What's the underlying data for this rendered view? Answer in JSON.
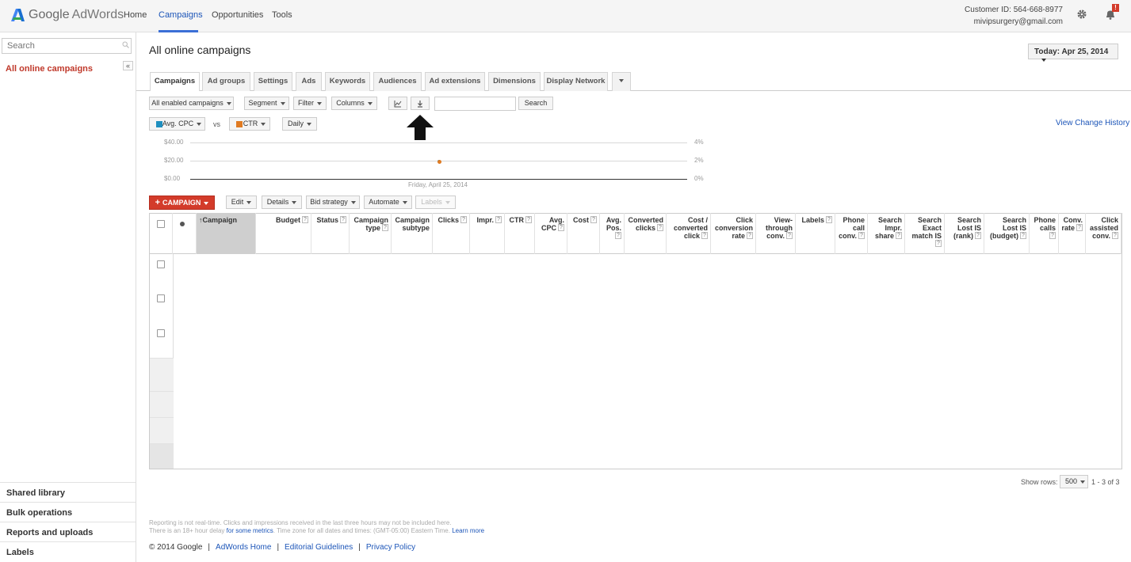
{
  "header": {
    "logo_google": "Google",
    "logo_adwords": "AdWords",
    "nav": [
      "Home",
      "Campaigns",
      "Opportunities",
      "Tools"
    ],
    "active_nav": "Campaigns",
    "customer_id": "Customer ID: 564-668-8977",
    "email": "mivipsurgery@gmail.com",
    "notification_count": "!",
    "icons": [
      "gear-icon",
      "bell-icon"
    ]
  },
  "sidebar": {
    "search_placeholder": "Search",
    "all_online": "All online campaigns",
    "collapse": "«",
    "bottom_items": [
      "Shared library",
      "Bulk operations",
      "Reports and uploads",
      "Labels"
    ]
  },
  "main": {
    "title": "All online campaigns",
    "date_range": "Today: Apr 25, 2014",
    "tabs": [
      "Campaigns",
      "Ad groups",
      "Settings",
      "Ads",
      "Keywords",
      "Audiences",
      "Ad extensions",
      "Dimensions",
      "Display Network"
    ],
    "active_tab": "Campaigns",
    "toolbar": {
      "filter_all": "All enabled campaigns",
      "segment": "Segment",
      "filter": "Filter",
      "columns": "Columns",
      "search_button": "Search",
      "search_value": ""
    },
    "metric_selectors": {
      "metric1": "Avg. CPC",
      "vs": "vs",
      "metric2": "CTR",
      "period": "Daily",
      "metric1_color": "#1f8fbf",
      "metric2_color": "#e07b22"
    },
    "view_change_history": "View Change History",
    "actions": {
      "campaign": "CAMPAIGN",
      "edit": "Edit",
      "details": "Details",
      "bid_strategy": "Bid strategy",
      "automate": "Automate",
      "labels": "Labels"
    },
    "table": {
      "columns": [
        "Campaign",
        "Budget",
        "Status",
        "Campaign type",
        "Campaign subtype",
        "Clicks",
        "Impr.",
        "CTR",
        "Avg. CPC",
        "Cost",
        "Avg. Pos.",
        "Converted clicks",
        "Cost / converted click",
        "Click conversion rate",
        "View-through conv.",
        "Labels",
        "Phone call conv.",
        "Search Impr. share",
        "Search Exact match IS",
        "Search Lost IS (rank)",
        "Search Lost IS (budget)",
        "Phone calls",
        "Conv. rate",
        "Click assisted conv."
      ],
      "row_count": 3
    },
    "pagination": {
      "show_rows_label": "Show rows:",
      "rows_value": "500",
      "range": "1 - 3 of 3"
    },
    "footnote_line1": "Reporting is not real-time. Clicks and impressions received in the last three hours may not be included here.",
    "footnote_line2_a": "There is an 18+ hour delay",
    "footnote_line2_link": "for some metrics",
    "footnote_line2_b": ". Time zone for all dates and times: (GMT-05:00) Eastern Time.",
    "footnote_learn_more": "Learn more",
    "footer": {
      "copyright": "© 2014 Google",
      "links": [
        "AdWords Home",
        "Editorial Guidelines",
        "Privacy Policy"
      ]
    }
  },
  "chart_data": {
    "type": "line",
    "x": [
      "Friday, April 25, 2014"
    ],
    "series": [
      {
        "name": "Avg. CPC",
        "values": [
          20.0
        ],
        "axis": "left",
        "color": "#1f8fbf"
      },
      {
        "name": "CTR",
        "values": [
          2
        ],
        "axis": "right",
        "color": "#e07b22"
      }
    ],
    "y_left_ticks": [
      "$40.00",
      "$20.00",
      "$0.00"
    ],
    "y_right_ticks": [
      "4%",
      "2%",
      "0%"
    ],
    "ylim_left": [
      0,
      40
    ],
    "ylim_right": [
      0,
      4
    ],
    "x_label": "Friday, April 25, 2014",
    "grid": true
  }
}
